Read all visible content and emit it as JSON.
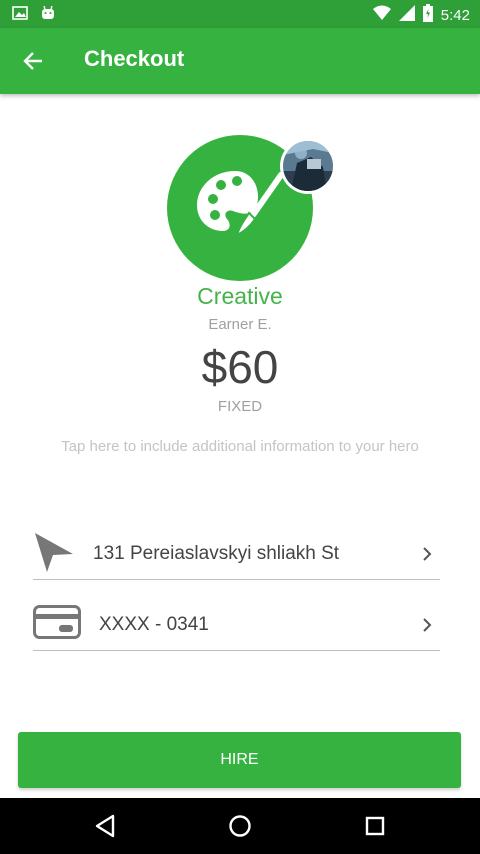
{
  "status_bar": {
    "time": "5:42",
    "icons": [
      "image-icon",
      "android-icon",
      "wifi-icon",
      "signal-icon",
      "battery-icon"
    ]
  },
  "app_bar": {
    "title": "Checkout",
    "back_icon": "arrow-left-icon"
  },
  "hero": {
    "icon": "palette-icon",
    "category": "Creative",
    "earner": "Earner E.",
    "price": "$60",
    "price_type": "FIXED",
    "info_hint": "Tap here to include additional information to your hero"
  },
  "address_row": {
    "icon": "location-arrow-icon",
    "text": "131 Pereiaslavskyi shliakh St"
  },
  "payment_row": {
    "icon": "credit-card-icon",
    "text": "XXXX - 0341"
  },
  "hire_button": {
    "label": "HIRE"
  },
  "nav_bar": {
    "icons": [
      "back-triangle-icon",
      "home-circle-icon",
      "recents-square-icon"
    ]
  },
  "colors": {
    "primary": "#35b23f",
    "status_bar": "#2f9f37",
    "text_dark": "#444444",
    "text_muted": "#a0a0a0"
  }
}
